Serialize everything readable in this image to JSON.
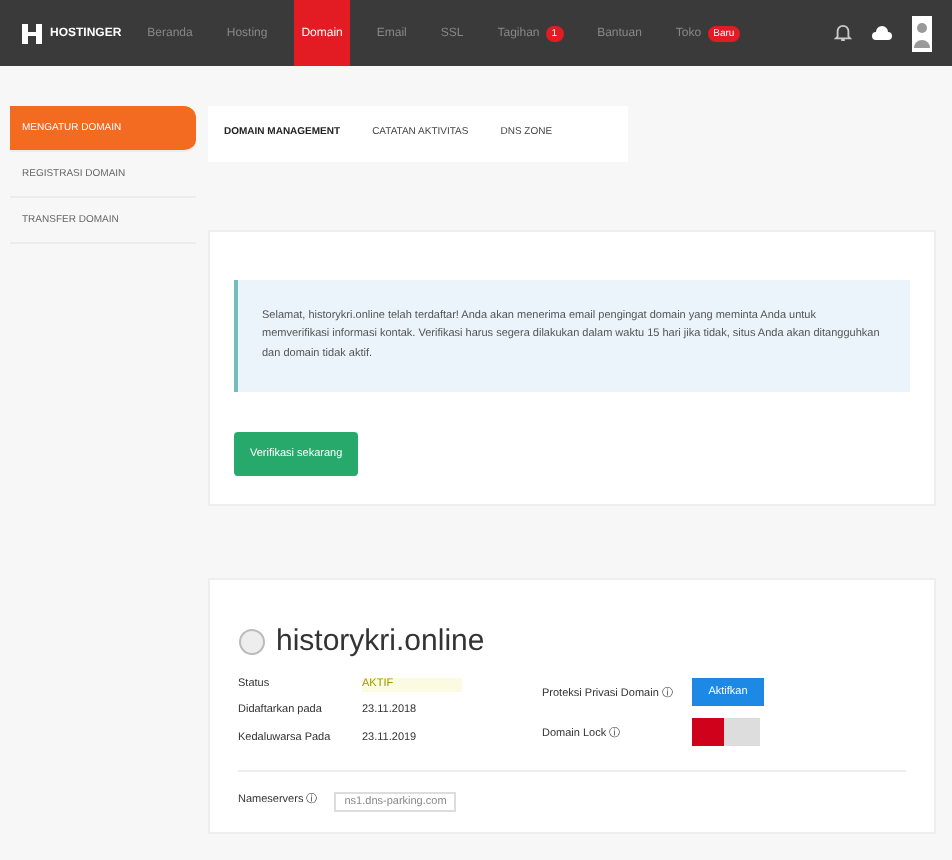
{
  "topbar": {
    "logo": "HOSTINGER",
    "nav": [
      {
        "label": "Beranda",
        "selected": false
      },
      {
        "label": "Hosting",
        "selected": false
      },
      {
        "label": "Domain",
        "selected": true
      },
      {
        "label": "Email",
        "selected": false
      },
      {
        "label": "SSL",
        "selected": false
      },
      {
        "label": "Tagihan",
        "selected": false,
        "badge": "1"
      },
      {
        "label": "Bantuan",
        "selected": false
      },
      {
        "label": "Toko",
        "selected": false,
        "badge": "Baru"
      }
    ]
  },
  "sidebar": {
    "items": [
      {
        "label": "MENGATUR DOMAIN",
        "selected": true
      },
      {
        "label": "REGISTRASI DOMAIN",
        "selected": false
      },
      {
        "label": "TRANSFER DOMAIN",
        "selected": false
      }
    ]
  },
  "tabs": [
    {
      "label": "DOMAIN MANAGEMENT",
      "selected": true
    },
    {
      "label": "CATATAN AKTIVITAS",
      "selected": false
    },
    {
      "label": "DNS ZONE",
      "selected": false
    }
  ],
  "notice": {
    "text": "Selamat, historykri.online telah terdaftar! Anda akan menerima email pengingat domain yang meminta Anda untuk memverifikasi informasi kontak. Verifikasi harus segera dilakukan dalam waktu 15 hari jika tidak, situs Anda akan ditangguhkan dan domain tidak aktif."
  },
  "verify_button": "Verifikasi sekarang",
  "domain": {
    "name": "historykri.online",
    "details": [
      {
        "label": "Status",
        "value": "AKTIF",
        "kind": "status"
      },
      {
        "label": "Didaftarkan pada",
        "value": "23.11.2018",
        "kind": "plain"
      },
      {
        "label": "Kedaluwarsa Pada",
        "value": "23.11.2019",
        "kind": "plain"
      }
    ],
    "privacy": {
      "label": "Proteksi Privasi Domain ⓘ",
      "button": "Aktifkan"
    },
    "lock": {
      "label": "Domain Lock ⓘ",
      "on": false
    },
    "nameservers": {
      "label": "Nameservers ⓘ",
      "value": "ns1.dns-parking.com"
    }
  }
}
